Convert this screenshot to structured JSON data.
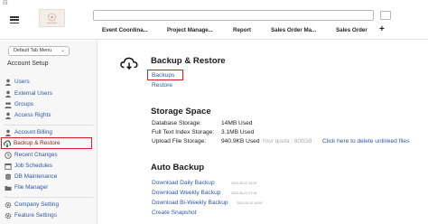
{
  "header": {
    "tabs": [
      "Event Coordina...",
      "Project Manage...",
      "Report",
      "Sales Order Ma...",
      "Sales Order"
    ],
    "add_tab_symbol": "+",
    "window_icon_glyph": "⊟"
  },
  "sidebar": {
    "tab_menu": "Default Tab Menu",
    "section_header": "Account Setup",
    "items": [
      {
        "label": "Users",
        "icon": "person-icon"
      },
      {
        "label": "External Users",
        "icon": "person-icon"
      },
      {
        "label": "Groups",
        "icon": "group-icon"
      },
      {
        "label": "Access Rights",
        "icon": "key-icon"
      },
      {
        "label": "Account Billing",
        "icon": "person-icon"
      },
      {
        "label": "Backup & Restore",
        "icon": "cloud-download-icon",
        "active": true
      },
      {
        "label": "Recent Changes",
        "icon": "clock-icon"
      },
      {
        "label": "Job Schedules",
        "icon": "calendar-icon"
      },
      {
        "label": "DB Maintenance",
        "icon": "database-icon"
      },
      {
        "label": "File Manager",
        "icon": "folder-icon"
      },
      {
        "label": "Company Setting",
        "icon": "gear-icon"
      },
      {
        "label": "Feature Settings",
        "icon": "gear-icon"
      }
    ]
  },
  "main": {
    "backup_restore": {
      "title": "Backup & Restore",
      "icon": "cloud-download-icon",
      "links": [
        "Backups",
        "Restore"
      ]
    },
    "storage": {
      "title": "Storage Space",
      "rows": [
        {
          "label": "Database Storage:",
          "value": "14MB Used"
        },
        {
          "label": "Full Text Index Storage:",
          "value": "3.1MB Used"
        },
        {
          "label": "Upload File Storage:",
          "value": "940.9KB Used"
        }
      ],
      "quota": "Your quota : 600GB",
      "unlinked_link": "Click here to delete unlinked files"
    },
    "auto_backup": {
      "title": "Auto Backup",
      "links": [
        {
          "label": "Download Daily Backup",
          "timestamp": "2023-05-22 15:09"
        },
        {
          "label": "Download Weekly Backup",
          "timestamp": "2023-05-21 07:15"
        },
        {
          "label": "Download Bi-Weekly Backup",
          "timestamp": "2023-05-15 16:50"
        },
        {
          "label": "Create Snapshot",
          "timestamp": ""
        }
      ]
    }
  },
  "colors": {
    "link": "#2d57a6",
    "highlight": "#d42020",
    "sidebar_bg": "#f7f7f7"
  }
}
